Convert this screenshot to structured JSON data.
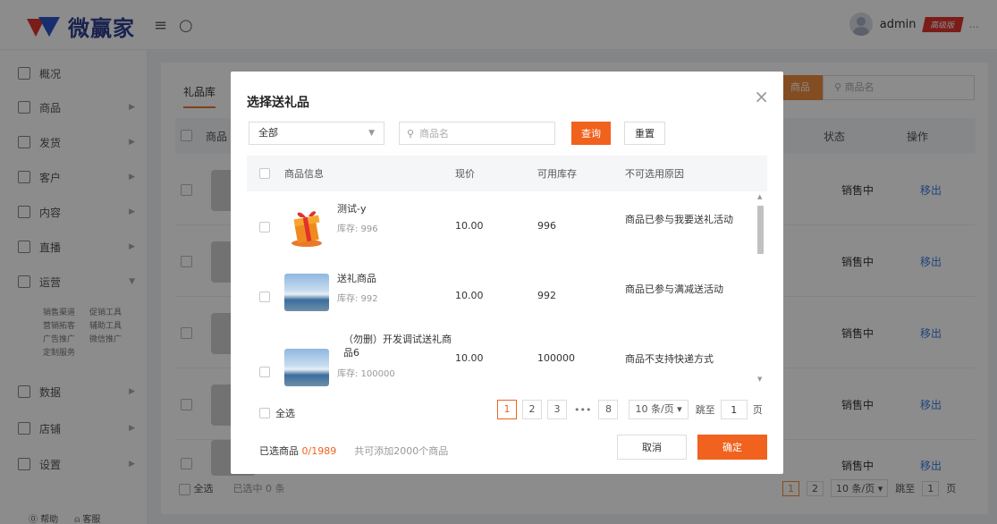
{
  "header": {
    "brand": "微赢家",
    "username": "admin",
    "badge": "高级版",
    "more": "...",
    "menu_icon": "menu-icon",
    "refresh_icon": "refresh-icon"
  },
  "sidebar": {
    "items": [
      {
        "label": "概况"
      },
      {
        "label": "商品"
      },
      {
        "label": "发货"
      },
      {
        "label": "客户"
      },
      {
        "label": "内容"
      },
      {
        "label": "直播"
      },
      {
        "label": "运营"
      },
      {
        "label": "数据"
      },
      {
        "label": "店铺"
      },
      {
        "label": "设置"
      }
    ],
    "sub_items": [
      "销售渠道",
      "促销工具",
      "营销拓客",
      "辅助工具",
      "广告推广",
      "微信推广",
      "定制服务"
    ],
    "help": "帮助",
    "service": "客服"
  },
  "background": {
    "tab": "礼品库",
    "add_button": "商品",
    "search_placeholder": "商品名",
    "col_product": "商品",
    "col_status": "状态",
    "col_action": "操作",
    "rows": [
      {
        "status": "销售中",
        "action": "移出"
      },
      {
        "status": "销售中",
        "action": "移出"
      },
      {
        "status": "销售中",
        "action": "移出"
      },
      {
        "status": "销售中",
        "action": "移出"
      },
      {
        "status": "销售中",
        "action": "移出"
      }
    ],
    "select_all": "全选",
    "selected": "已选中 0 条",
    "page_current": "1",
    "page_next": "2",
    "page_size": "10 条/页",
    "jump_label": "跳至",
    "jump_value": "1",
    "jump_unit": "页"
  },
  "modal": {
    "title": "选择送礼品",
    "filter": {
      "selected": "全部"
    },
    "search": {
      "placeholder": "商品名"
    },
    "query_button": "查询",
    "reset_button": "重置",
    "columns": [
      "商品信息",
      "现价",
      "可用库存",
      "不可选用原因"
    ],
    "rows": [
      {
        "name": "测试-y",
        "stock_label": "库存: 996",
        "price": "10.00",
        "available": "996",
        "reason": "商品已参与我要送礼活动",
        "image": "gift-box-icon"
      },
      {
        "name": "送礼商品",
        "stock_label": "库存: 992",
        "price": "10.00",
        "available": "992",
        "reason": "商品已参与满减送活动",
        "image": "landscape-photo"
      },
      {
        "name": "（勿删）开发调试送礼商品6",
        "stock_label": "库存: 100000",
        "price": "10.00",
        "available": "100000",
        "reason": "商品不支持快递方式",
        "image": "landscape-photo"
      }
    ],
    "select_all": "全选",
    "pagination": {
      "pages": [
        "1",
        "2",
        "3",
        "8"
      ],
      "current": "1",
      "ellipsis": "•••",
      "page_size": "10 条/页",
      "jump_label": "跳至",
      "jump_value": "1",
      "jump_unit": "页"
    },
    "selected_prefix": "已选商品",
    "selected_count": "0/1989",
    "limit_hint": "共可添加2000个商品",
    "cancel_button": "取消",
    "confirm_button": "确定"
  },
  "colors": {
    "accent": "#f0621e",
    "link": "#3b7be0",
    "brand_red": "#e0332d",
    "brand_blue": "#2f55c8"
  }
}
